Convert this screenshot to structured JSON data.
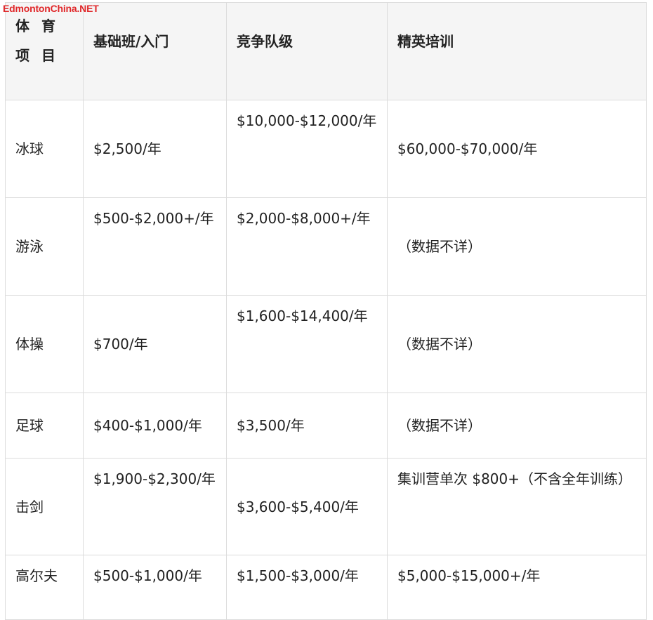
{
  "watermark": "EdmontonChina.NET",
  "table": {
    "headers": [
      "体 育 项 目",
      "基础班/入门",
      "竞争队级",
      "精英培训"
    ],
    "rows": [
      [
        "冰球",
        "$2,500/年",
        "$10,000-$12,000/年",
        "$60,000-$70,000/年"
      ],
      [
        "游泳",
        "$500-$2,000+/年",
        "$2,000-$8,000+/年",
        "（数据不详）"
      ],
      [
        "体操",
        "$700/年",
        "$1,600-$14,400/年",
        "（数据不详）"
      ],
      [
        "足球",
        "$400-$1,000/年",
        "$3,500/年",
        "（数据不详）"
      ],
      [
        "击剑",
        "$1,900-$2,300/年",
        "$3,600-$5,400/年",
        "集训营单次 $800+（不含全年训练）"
      ],
      [
        "高尔夫",
        "$500-$1,000/年",
        "$1,500-$3,000/年",
        "$5,000-$15,000+/年"
      ]
    ]
  },
  "colors": {
    "watermark": "#e0282a",
    "header_bg": "#f5f5f5",
    "border": "#dcdcdc",
    "text": "#222222"
  }
}
